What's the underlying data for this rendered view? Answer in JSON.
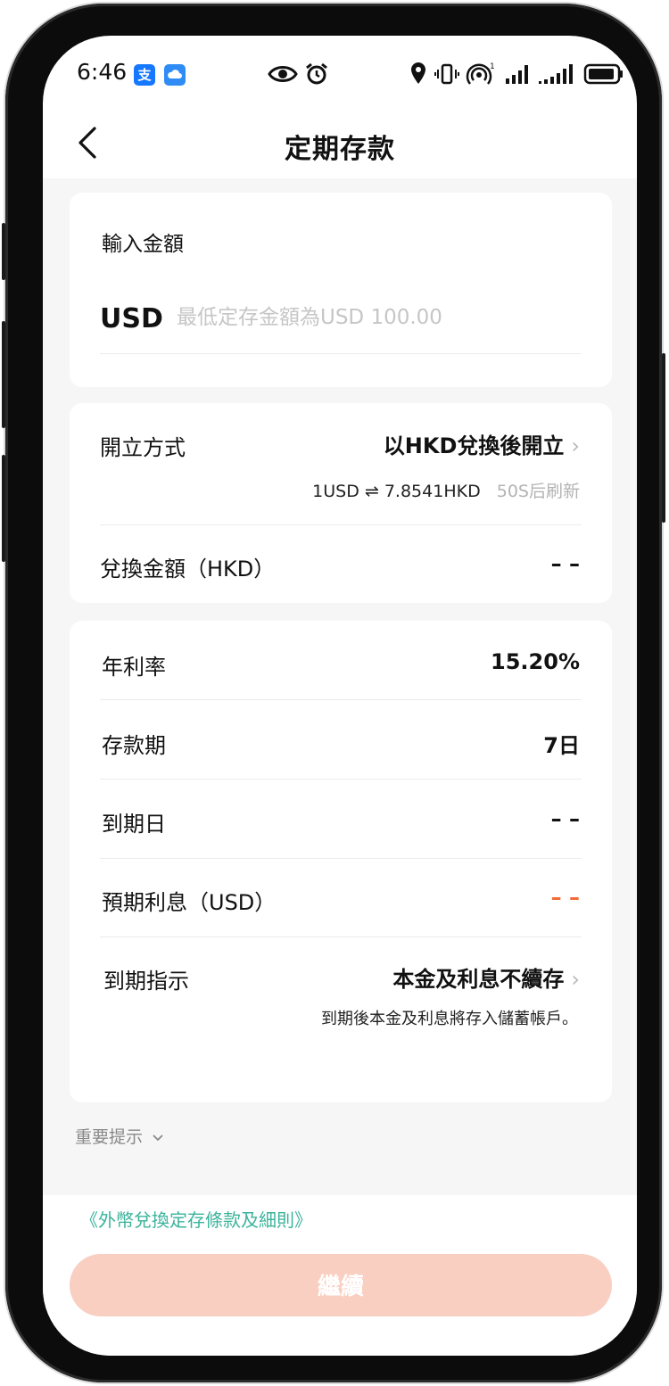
{
  "status_bar": {
    "time": "6:46",
    "alipay_icon_char": "支"
  },
  "nav": {
    "title": "定期存款"
  },
  "amount_card": {
    "label": "輸入金額",
    "currency": "USD",
    "placeholder": "最低定存金額為USD 100.00"
  },
  "method_card": {
    "method_label": "開立方式",
    "method_value": "以HKD兌換後開立",
    "rate_text": "1USD ⇌ 7.8541HKD",
    "refresh_text": "50S后刷新",
    "exchange_label": "兌換金額（HKD）",
    "exchange_value": "– –"
  },
  "detail_card": {
    "rows": [
      {
        "label": "年利率",
        "value": "15.20%"
      },
      {
        "label": "存款期",
        "value": "7日"
      },
      {
        "label": "到期日",
        "value": "– –"
      },
      {
        "label": "預期利息（USD）",
        "value": "– –"
      }
    ],
    "instruction_label": "到期指示",
    "instruction_value": "本金及利息不續存",
    "instruction_note": "到期後本金及利息將存入儲蓄帳戶。"
  },
  "notice": {
    "label": "重要提示"
  },
  "terms_link": "《外幣兌換定存條款及細則》",
  "continue_button": "繼續",
  "colors": {
    "accent_green": "#3bb39b",
    "orange": "#f26b3a",
    "button_disabled": "#f9cfc1"
  }
}
